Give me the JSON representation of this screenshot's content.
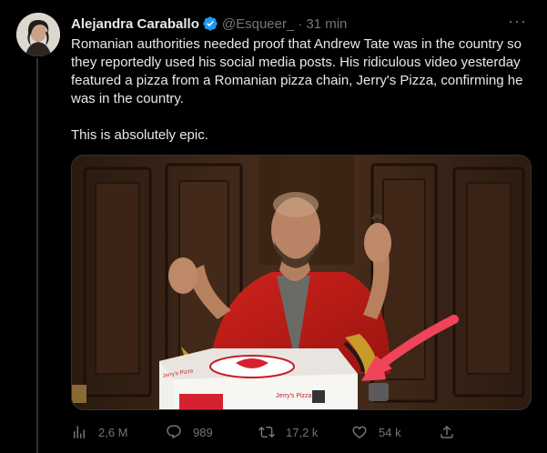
{
  "author": {
    "name": "Alejandra Caraballo",
    "handle": "@Esqueer_",
    "separator": "·",
    "time": "31 min",
    "verified": true
  },
  "tweet": {
    "paragraph1": "Romanian authorities needed proof that Andrew Tate was in the country so they reportedly used his social media posts. His ridiculous video yesterday featured a pizza from a Romanian pizza chain, Jerry's Pizza, confirming he was in the country.",
    "paragraph2": "This is absolutely epic."
  },
  "media": {
    "box_text_1": "Jerry's Pizza",
    "box_text_2": "Jerry's Pizza"
  },
  "actions": {
    "views": "2,6 M",
    "replies": "989",
    "retweets": "17,2 k",
    "likes": "54 k"
  },
  "colors": {
    "background": "#000000",
    "text": "#e7e9ea",
    "secondary": "#71767b",
    "verified": "#1d9bf0",
    "arrow": "#f0445a"
  },
  "icons": {
    "more": "more-dots-icon",
    "views": "views-bar-icon",
    "reply": "reply-bubble-icon",
    "retweet": "retweet-icon",
    "like": "heart-icon",
    "share": "share-icon",
    "verified": "verified-badge-icon"
  }
}
